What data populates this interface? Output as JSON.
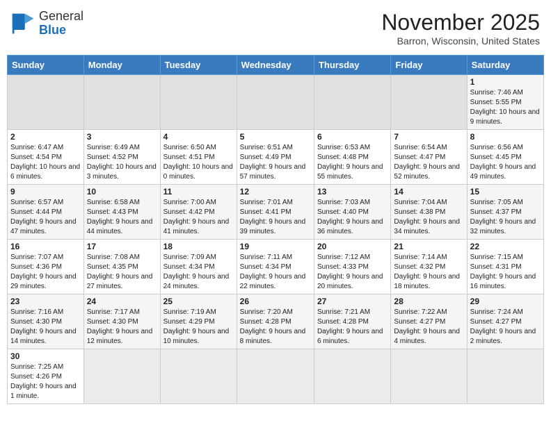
{
  "header": {
    "logo_general": "General",
    "logo_blue": "Blue",
    "month_title": "November 2025",
    "location": "Barron, Wisconsin, United States"
  },
  "days_of_week": [
    "Sunday",
    "Monday",
    "Tuesday",
    "Wednesday",
    "Thursday",
    "Friday",
    "Saturday"
  ],
  "weeks": [
    {
      "days": [
        {
          "num": "",
          "info": ""
        },
        {
          "num": "",
          "info": ""
        },
        {
          "num": "",
          "info": ""
        },
        {
          "num": "",
          "info": ""
        },
        {
          "num": "",
          "info": ""
        },
        {
          "num": "",
          "info": ""
        },
        {
          "num": "1",
          "info": "Sunrise: 7:46 AM\nSunset: 5:55 PM\nDaylight: 10 hours and 9 minutes."
        }
      ]
    },
    {
      "days": [
        {
          "num": "2",
          "info": "Sunrise: 6:47 AM\nSunset: 4:54 PM\nDaylight: 10 hours and 6 minutes."
        },
        {
          "num": "3",
          "info": "Sunrise: 6:49 AM\nSunset: 4:52 PM\nDaylight: 10 hours and 3 minutes."
        },
        {
          "num": "4",
          "info": "Sunrise: 6:50 AM\nSunset: 4:51 PM\nDaylight: 10 hours and 0 minutes."
        },
        {
          "num": "5",
          "info": "Sunrise: 6:51 AM\nSunset: 4:49 PM\nDaylight: 9 hours and 57 minutes."
        },
        {
          "num": "6",
          "info": "Sunrise: 6:53 AM\nSunset: 4:48 PM\nDaylight: 9 hours and 55 minutes."
        },
        {
          "num": "7",
          "info": "Sunrise: 6:54 AM\nSunset: 4:47 PM\nDaylight: 9 hours and 52 minutes."
        },
        {
          "num": "8",
          "info": "Sunrise: 6:56 AM\nSunset: 4:45 PM\nDaylight: 9 hours and 49 minutes."
        }
      ]
    },
    {
      "days": [
        {
          "num": "9",
          "info": "Sunrise: 6:57 AM\nSunset: 4:44 PM\nDaylight: 9 hours and 47 minutes."
        },
        {
          "num": "10",
          "info": "Sunrise: 6:58 AM\nSunset: 4:43 PM\nDaylight: 9 hours and 44 minutes."
        },
        {
          "num": "11",
          "info": "Sunrise: 7:00 AM\nSunset: 4:42 PM\nDaylight: 9 hours and 41 minutes."
        },
        {
          "num": "12",
          "info": "Sunrise: 7:01 AM\nSunset: 4:41 PM\nDaylight: 9 hours and 39 minutes."
        },
        {
          "num": "13",
          "info": "Sunrise: 7:03 AM\nSunset: 4:40 PM\nDaylight: 9 hours and 36 minutes."
        },
        {
          "num": "14",
          "info": "Sunrise: 7:04 AM\nSunset: 4:38 PM\nDaylight: 9 hours and 34 minutes."
        },
        {
          "num": "15",
          "info": "Sunrise: 7:05 AM\nSunset: 4:37 PM\nDaylight: 9 hours and 32 minutes."
        }
      ]
    },
    {
      "days": [
        {
          "num": "16",
          "info": "Sunrise: 7:07 AM\nSunset: 4:36 PM\nDaylight: 9 hours and 29 minutes."
        },
        {
          "num": "17",
          "info": "Sunrise: 7:08 AM\nSunset: 4:35 PM\nDaylight: 9 hours and 27 minutes."
        },
        {
          "num": "18",
          "info": "Sunrise: 7:09 AM\nSunset: 4:34 PM\nDaylight: 9 hours and 24 minutes."
        },
        {
          "num": "19",
          "info": "Sunrise: 7:11 AM\nSunset: 4:34 PM\nDaylight: 9 hours and 22 minutes."
        },
        {
          "num": "20",
          "info": "Sunrise: 7:12 AM\nSunset: 4:33 PM\nDaylight: 9 hours and 20 minutes."
        },
        {
          "num": "21",
          "info": "Sunrise: 7:14 AM\nSunset: 4:32 PM\nDaylight: 9 hours and 18 minutes."
        },
        {
          "num": "22",
          "info": "Sunrise: 7:15 AM\nSunset: 4:31 PM\nDaylight: 9 hours and 16 minutes."
        }
      ]
    },
    {
      "days": [
        {
          "num": "23",
          "info": "Sunrise: 7:16 AM\nSunset: 4:30 PM\nDaylight: 9 hours and 14 minutes."
        },
        {
          "num": "24",
          "info": "Sunrise: 7:17 AM\nSunset: 4:30 PM\nDaylight: 9 hours and 12 minutes."
        },
        {
          "num": "25",
          "info": "Sunrise: 7:19 AM\nSunset: 4:29 PM\nDaylight: 9 hours and 10 minutes."
        },
        {
          "num": "26",
          "info": "Sunrise: 7:20 AM\nSunset: 4:28 PM\nDaylight: 9 hours and 8 minutes."
        },
        {
          "num": "27",
          "info": "Sunrise: 7:21 AM\nSunset: 4:28 PM\nDaylight: 9 hours and 6 minutes."
        },
        {
          "num": "28",
          "info": "Sunrise: 7:22 AM\nSunset: 4:27 PM\nDaylight: 9 hours and 4 minutes."
        },
        {
          "num": "29",
          "info": "Sunrise: 7:24 AM\nSunset: 4:27 PM\nDaylight: 9 hours and 2 minutes."
        }
      ]
    },
    {
      "days": [
        {
          "num": "30",
          "info": "Sunrise: 7:25 AM\nSunset: 4:26 PM\nDaylight: 9 hours and 1 minute."
        },
        {
          "num": "",
          "info": ""
        },
        {
          "num": "",
          "info": ""
        },
        {
          "num": "",
          "info": ""
        },
        {
          "num": "",
          "info": ""
        },
        {
          "num": "",
          "info": ""
        },
        {
          "num": "",
          "info": ""
        }
      ]
    }
  ]
}
